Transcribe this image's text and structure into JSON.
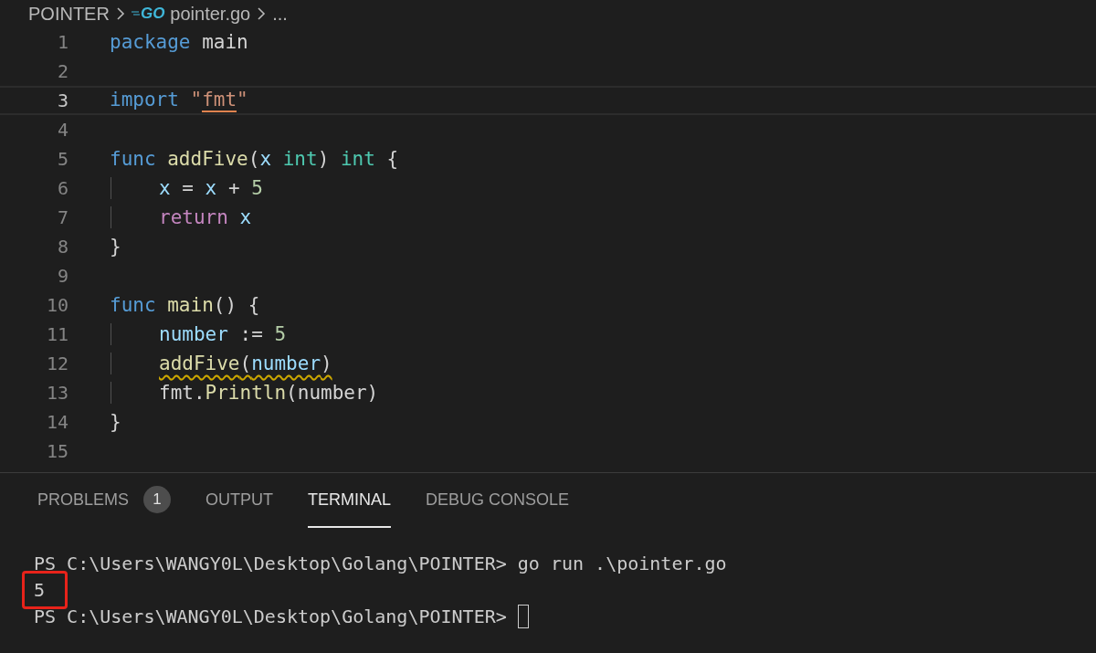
{
  "breadcrumb": [
    {
      "label": "POINTER"
    },
    {
      "label": "pointer.go",
      "file_badge": "GO"
    },
    {
      "label": "..."
    }
  ],
  "editor": {
    "lines": [
      {
        "number": "1",
        "current": false,
        "tokens": [
          {
            "kind": "keyword",
            "text": "package "
          },
          {
            "kind": "plain",
            "text": "main"
          }
        ]
      },
      {
        "number": "2",
        "current": false
      },
      {
        "number": "3",
        "current": true,
        "tokens": [
          {
            "kind": "keyword",
            "text": "import "
          },
          {
            "kind": "string",
            "text": "\""
          },
          {
            "kind": "string",
            "text": "fmt",
            "error": true
          },
          {
            "kind": "string",
            "text": "\""
          }
        ]
      },
      {
        "number": "4",
        "current": false
      },
      {
        "number": "5",
        "current": false,
        "tokens": [
          {
            "kind": "keyword",
            "text": "func "
          },
          {
            "kind": "function",
            "text": "addFive"
          },
          {
            "kind": "plain",
            "text": "("
          },
          {
            "kind": "variable",
            "text": "x "
          },
          {
            "kind": "type",
            "text": "int"
          },
          {
            "kind": "plain",
            "text": ") "
          },
          {
            "kind": "type",
            "text": "int"
          },
          {
            "kind": "plain",
            "text": " {"
          }
        ]
      },
      {
        "number": "6",
        "current": false,
        "indented": true,
        "tokens": [
          {
            "kind": "variable",
            "text": "x"
          },
          {
            "kind": "plain",
            "text": " = "
          },
          {
            "kind": "variable",
            "text": "x"
          },
          {
            "kind": "plain",
            "text": " + "
          },
          {
            "kind": "number",
            "text": "5"
          }
        ]
      },
      {
        "number": "7",
        "current": false,
        "indented": true,
        "tokens": [
          {
            "kind": "control",
            "text": "return "
          },
          {
            "kind": "variable",
            "text": "x"
          }
        ]
      },
      {
        "number": "8",
        "current": false,
        "tokens": [
          {
            "kind": "plain",
            "text": "}"
          }
        ]
      },
      {
        "number": "9",
        "current": false
      },
      {
        "number": "10",
        "current": false,
        "tokens": [
          {
            "kind": "keyword",
            "text": "func "
          },
          {
            "kind": "function",
            "text": "main"
          },
          {
            "kind": "plain",
            "text": "() {"
          }
        ]
      },
      {
        "number": "11",
        "current": false,
        "indented": true,
        "tokens": [
          {
            "kind": "variable",
            "text": "number"
          },
          {
            "kind": "plain",
            "text": " := "
          },
          {
            "kind": "number",
            "text": "5"
          }
        ]
      },
      {
        "number": "12",
        "current": false,
        "indented": true,
        "tokens": [
          {
            "kind": "function",
            "text": "addFive",
            "warning": true
          },
          {
            "kind": "plain",
            "text": "(",
            "warning": true
          },
          {
            "kind": "variable",
            "text": "number",
            "warning": true
          },
          {
            "kind": "plain",
            "text": ")",
            "warning": true
          }
        ]
      },
      {
        "number": "13",
        "current": false,
        "indented": true,
        "tokens": [
          {
            "kind": "plain",
            "text": "fmt."
          },
          {
            "kind": "function",
            "text": "Println"
          },
          {
            "kind": "plain",
            "text": "(number)"
          }
        ]
      },
      {
        "number": "14",
        "current": false,
        "tokens": [
          {
            "kind": "plain",
            "text": "}"
          }
        ]
      },
      {
        "number": "15",
        "current": false
      }
    ]
  },
  "panel": {
    "tabs": [
      {
        "label": "PROBLEMS",
        "badge": "1",
        "selected": false
      },
      {
        "label": "OUTPUT",
        "selected": false
      },
      {
        "label": "TERMINAL",
        "selected": true
      },
      {
        "label": "DEBUG CONSOLE",
        "selected": false
      }
    ],
    "terminal": [
      {
        "text": "PS C:\\Users\\WANGY0L\\Desktop\\Golang\\POINTER> go run .\\pointer.go",
        "highlighted": false,
        "cursor": false
      },
      {
        "text": "5",
        "highlighted": true,
        "cursor": false
      },
      {
        "text": "PS C:\\Users\\WANGY0L\\Desktop\\Golang\\POINTER>",
        "highlighted": false,
        "cursor": true
      }
    ]
  }
}
